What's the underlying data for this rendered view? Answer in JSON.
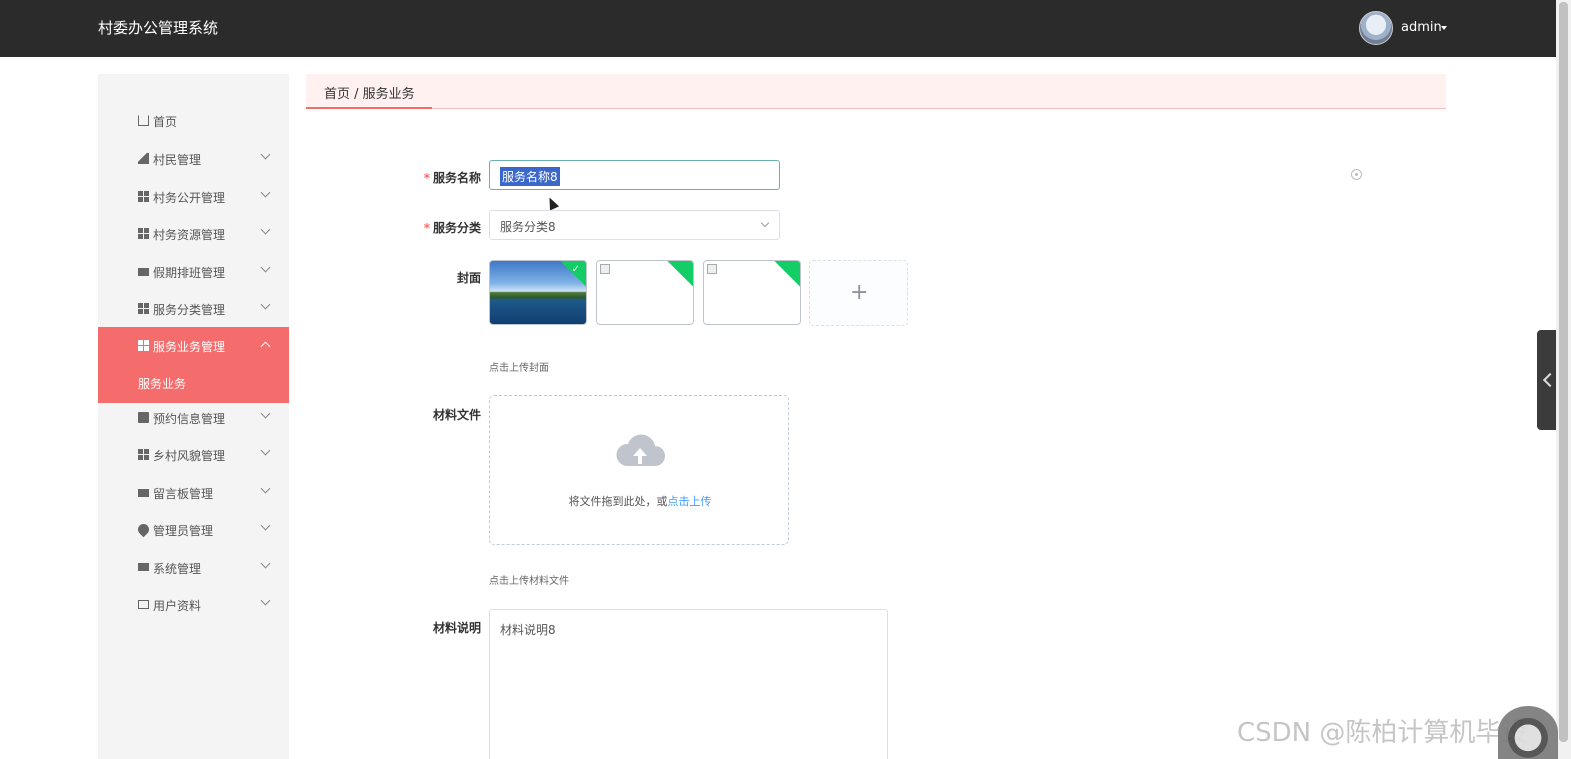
{
  "header": {
    "title": "村委办公管理系统",
    "user_name": "admin"
  },
  "sidebar": {
    "items": [
      {
        "label": "首页",
        "icon": "home-icon"
      },
      {
        "label": "村民管理",
        "icon": "send-icon"
      },
      {
        "label": "村务公开管理",
        "icon": "grid-icon"
      },
      {
        "label": "村务资源管理",
        "icon": "grid-icon"
      },
      {
        "label": "假期排班管理",
        "icon": "message-icon"
      },
      {
        "label": "服务分类管理",
        "icon": "grid-icon"
      },
      {
        "label": "服务业务管理",
        "icon": "grid-icon",
        "expanded": true,
        "children": [
          "服务业务"
        ]
      },
      {
        "label": "预约信息管理",
        "icon": "clipboard-icon"
      },
      {
        "label": "乡村风貌管理",
        "icon": "grid-icon"
      },
      {
        "label": "留言板管理",
        "icon": "printer-icon"
      },
      {
        "label": "管理员管理",
        "icon": "location-icon"
      },
      {
        "label": "系统管理",
        "icon": "monitor-icon"
      },
      {
        "label": "用户资料",
        "icon": "card-icon"
      }
    ]
  },
  "breadcrumb": {
    "text": "首页 / 服务业务"
  },
  "form": {
    "name_label": "服务名称",
    "name_value": "服务名称8",
    "category_label": "服务分类",
    "category_value": "服务分类8",
    "cover_label": "封面",
    "cover_hint": "点击上传封面",
    "file_label": "材料文件",
    "drag_text": "将文件拖到此处，或",
    "drag_link": "点击上传",
    "file_hint": "点击上传材料文件",
    "desc_label": "材料说明",
    "desc_value": "材料说明8"
  },
  "watermark": "CSDN @陈柏计算机毕设",
  "colors": {
    "accent": "#f56c6c",
    "topbar": "#2b2b2b",
    "success": "#13ce66",
    "link": "#409eff"
  }
}
